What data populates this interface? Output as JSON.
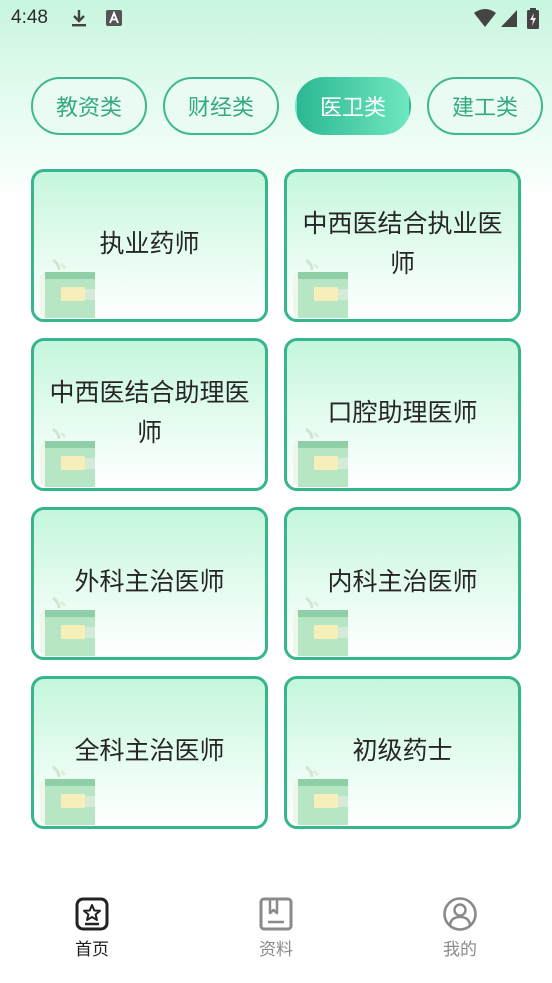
{
  "status_bar": {
    "time": "4:48"
  },
  "tabs": [
    {
      "label": "教资类",
      "active": false
    },
    {
      "label": "财经类",
      "active": false
    },
    {
      "label": "医卫类",
      "active": true
    },
    {
      "label": "建工类",
      "active": false
    }
  ],
  "cards": [
    {
      "title": "执业药师"
    },
    {
      "title": "中西医结合执业医师"
    },
    {
      "title": "中西医结合助理医师"
    },
    {
      "title": "口腔助理医师"
    },
    {
      "title": "外科主治医师"
    },
    {
      "title": "内科主治医师"
    },
    {
      "title": "全科主治医师"
    },
    {
      "title": "初级药士"
    }
  ],
  "bottom_nav": [
    {
      "label": "首页",
      "icon": "home-star-icon",
      "active": true
    },
    {
      "label": "资料",
      "icon": "document-icon",
      "active": false
    },
    {
      "label": "我的",
      "icon": "profile-icon",
      "active": false
    }
  ],
  "colors": {
    "accent": "#35b68c",
    "active_tab_start": "#2cb892",
    "active_tab_end": "#6fe7c0",
    "background_top": "#c8f5df"
  }
}
